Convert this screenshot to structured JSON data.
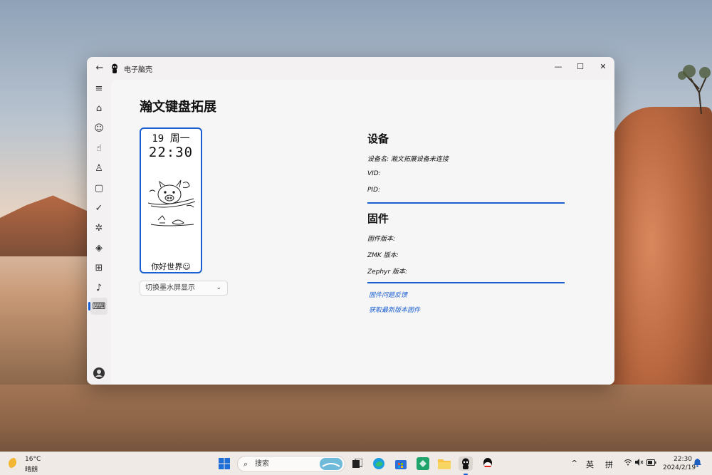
{
  "window": {
    "app_title": "电子脑壳",
    "back_icon": "back-arrow-icon",
    "controls": {
      "minimize": "—",
      "maximize": "☐",
      "close": "✕"
    }
  },
  "sidebar": {
    "items": [
      {
        "name": "menu",
        "icon": "hamburger-icon",
        "glyph": "≡"
      },
      {
        "name": "home",
        "icon": "home-icon",
        "glyph": "⌂"
      },
      {
        "name": "emoji",
        "icon": "smiley-icon",
        "glyph": "☺"
      },
      {
        "name": "touch",
        "icon": "hand-pointer-icon",
        "glyph": "☝"
      },
      {
        "name": "accessibility",
        "icon": "person-icon",
        "glyph": "♙"
      },
      {
        "name": "frame",
        "icon": "frame-icon",
        "glyph": "▢"
      },
      {
        "name": "check",
        "icon": "checkmark-icon",
        "glyph": "✓"
      },
      {
        "name": "puzzle",
        "icon": "puzzle-icon",
        "glyph": "✲"
      },
      {
        "name": "shapes",
        "icon": "shapes-icon",
        "glyph": "◈"
      },
      {
        "name": "gamepad",
        "icon": "gamepad-icon",
        "glyph": "⊞"
      },
      {
        "name": "microphone",
        "icon": "microphone-icon",
        "glyph": "♪"
      },
      {
        "name": "keyboard",
        "icon": "keyboard-icon",
        "glyph": "⌨",
        "active": true
      }
    ],
    "account_icon": "account-icon",
    "settings_icon": "gear-icon"
  },
  "main": {
    "page_title": "瀚文键盘拓展",
    "eink": {
      "date": "19 周一",
      "time": "22:30",
      "greeting": "你好世界☺",
      "art_icon": "flying-pig-illustration"
    },
    "display_select": {
      "value": "切换墨水屏显示"
    },
    "device": {
      "title": "设备",
      "name_line": "设备名: 瀚文拓展设备未连接",
      "vid_line": "VID:",
      "pid_line": "PID:"
    },
    "firmware": {
      "title": "固件",
      "fw_version_line": "固件版本:",
      "zmk_version_line": "ZMK 版本:",
      "zephyr_version_line": "Zephyr 版本:"
    },
    "links": {
      "feedback": "固件问题反馈",
      "latest": "获取最新版本固件"
    }
  },
  "taskbar": {
    "weather": {
      "temp": "16°C",
      "desc": "晴朗",
      "icon": "moon-icon"
    },
    "search_placeholder": "搜索",
    "apps": [
      "windows-start-icon",
      "search-highlight-icon",
      "task-view-icon",
      "edge-icon",
      "store-icon",
      "app-green-icon",
      "file-explorer-icon",
      "electronic-brain-shell-icon",
      "qq-icon"
    ],
    "tray": {
      "chevron": "^",
      "ime_lang": "英",
      "ime_mode": "拼"
    },
    "clock": {
      "time": "22:30",
      "date": "2024/2/19"
    }
  },
  "colors": {
    "accent": "#1a5fd1",
    "window_bg": "#f3f1f1"
  }
}
